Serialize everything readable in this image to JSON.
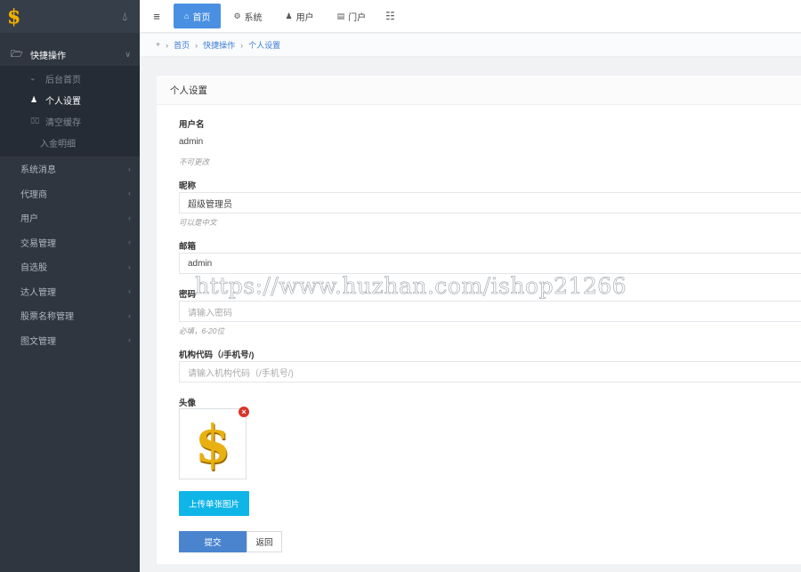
{
  "colors": {
    "sidebar_bg": "#2f3640",
    "accent": "#4a90e2",
    "upload_btn": "#10b5e8",
    "logo": "#f0b400"
  },
  "sidebar": {
    "logo_glyph": "$",
    "group": {
      "label": "快捷操作",
      "icon": "folder-open-icon",
      "sub_items": [
        {
          "label": "后台首页",
          "icon": "dashboard-icon",
          "active": false
        },
        {
          "label": "个人设置",
          "icon": "user-icon",
          "active": true
        },
        {
          "label": "清空缓存",
          "icon": "trash-icon",
          "active": false
        },
        {
          "label": "入金明细",
          "icon": "",
          "active": false
        }
      ]
    },
    "items": [
      {
        "label": "系统消息"
      },
      {
        "label": "代理商"
      },
      {
        "label": "用户"
      },
      {
        "label": "交易管理"
      },
      {
        "label": "自选股"
      },
      {
        "label": "达人管理"
      },
      {
        "label": "股票名称管理"
      },
      {
        "label": "图文管理"
      }
    ]
  },
  "topnav": {
    "items": [
      {
        "label": "首页",
        "icon": "home-icon",
        "active": true
      },
      {
        "label": "系统",
        "icon": "gear-icon",
        "active": false
      },
      {
        "label": "用户",
        "icon": "user-icon",
        "active": false
      },
      {
        "label": "门户",
        "icon": "portal-icon",
        "active": false
      }
    ]
  },
  "breadcrumb": {
    "home": "首页",
    "section": "快捷操作",
    "current": "个人设置"
  },
  "panel": {
    "title": "个人设置",
    "username": {
      "label": "用户名",
      "value": "admin",
      "help": "不可更改"
    },
    "nickname": {
      "label": "昵称",
      "value": "超级管理员",
      "help": "可以是中文"
    },
    "email": {
      "label": "邮箱",
      "value": "admin"
    },
    "password": {
      "label": "密码",
      "placeholder": "请输入密码",
      "help": "必填，6-20位"
    },
    "org_code": {
      "label": "机构代码（/手机号/)",
      "placeholder": "请输入机构代码（/手机号/)"
    },
    "avatar": {
      "label": "头像",
      "glyph": "$",
      "remove_glyph": "×"
    },
    "upload_label": "上传单张图片",
    "submit_label": "提交",
    "back_label": "返回"
  },
  "watermark": "https://www.huzhan.com/ishop21266"
}
